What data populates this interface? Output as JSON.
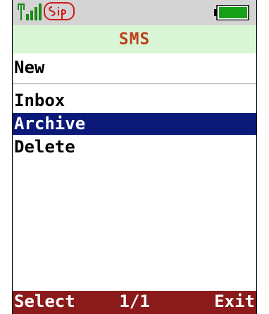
{
  "status_bar": {
    "signal_icon": "signal-strength-icon",
    "sip_icon": "sip-icon",
    "battery_icon": "battery-icon",
    "battery_level": 1.0
  },
  "title": "SMS",
  "new_label": "New",
  "menu": {
    "items": [
      {
        "label": "Inbox",
        "selected": false
      },
      {
        "label": "Archive",
        "selected": true
      },
      {
        "label": "Delete",
        "selected": false
      }
    ]
  },
  "softkeys": {
    "left": "Select",
    "center": "1/1",
    "right": "Exit"
  },
  "colors": {
    "title_text": "#c0401a",
    "title_bg": "#d8f5d6",
    "selection_bg": "#0b1a78",
    "softkey_bg": "#8b1a1a",
    "battery": "#18a018"
  }
}
